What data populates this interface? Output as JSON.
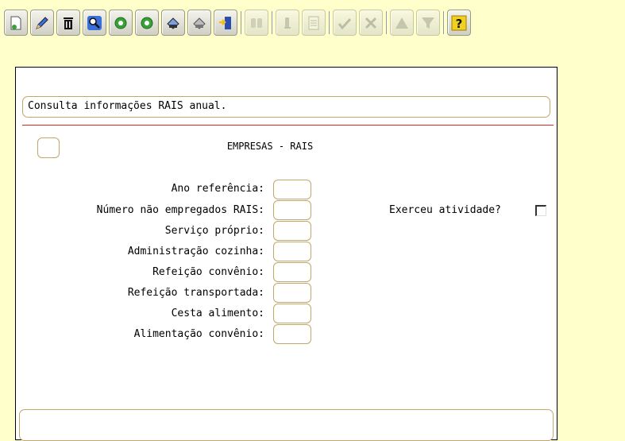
{
  "toolbar": {
    "buttons": [
      {
        "icon": "new-document-icon",
        "enabled": true
      },
      {
        "icon": "pencil-edit-icon",
        "enabled": true
      },
      {
        "icon": "trash-icon",
        "enabled": true
      },
      {
        "icon": "magnifier-search-icon",
        "enabled": true
      },
      {
        "icon": "previous-record-icon",
        "enabled": true
      },
      {
        "icon": "next-record-icon",
        "enabled": true
      },
      {
        "icon": "print-icon",
        "enabled": true
      },
      {
        "icon": "print-preview-icon",
        "enabled": true
      },
      {
        "icon": "exit-door-icon",
        "enabled": true
      },
      {
        "icon": "binoculars-icon",
        "enabled": false
      },
      {
        "icon": "number-one-icon",
        "enabled": false
      },
      {
        "icon": "number-list-icon",
        "enabled": false
      },
      {
        "icon": "confirm-check-icon",
        "enabled": false
      },
      {
        "icon": "cancel-x-icon",
        "enabled": false
      },
      {
        "icon": "triangle-up-icon",
        "enabled": false
      },
      {
        "icon": "filter-icon",
        "enabled": false
      },
      {
        "icon": "help-question-icon",
        "enabled": true
      }
    ]
  },
  "form": {
    "description": "Consulta informações RAIS anual.",
    "title": "EMPRESAS - RAIS",
    "fields": {
      "ano_referencia": {
        "label": "Ano referência:",
        "value": ""
      },
      "num_nao_empregados": {
        "label": "Número não empregados RAIS:",
        "value": ""
      },
      "servico_proprio": {
        "label": "Serviço próprio:",
        "value": ""
      },
      "administracao_cozinha": {
        "label": "Administração cozinha:",
        "value": ""
      },
      "refeicao_convenio": {
        "label": "Refeição convênio:",
        "value": ""
      },
      "refeicao_transportada": {
        "label": "Refeição transportada:",
        "value": ""
      },
      "cesta_alimento": {
        "label": "Cesta alimento:",
        "value": ""
      },
      "alimentacao_convenio": {
        "label": "Alimentação convênio:",
        "value": ""
      }
    },
    "exerceu_atividade": {
      "label": "Exerceu atividade?",
      "checked": false
    }
  },
  "colors": {
    "background": "#ffffcc",
    "panel": "#ffffff",
    "field_border": "#c2a66a",
    "separator": "#d42a20"
  }
}
